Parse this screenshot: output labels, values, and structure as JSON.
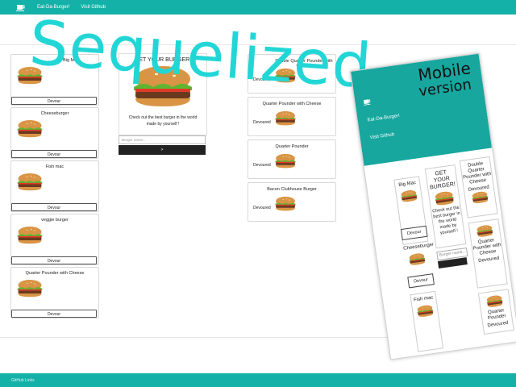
{
  "nav": {
    "brand": "Eat-Da-Burger!",
    "github": "Visit Github"
  },
  "watermark": "Sequelized",
  "left_cards": [
    {
      "name": "Big Mac",
      "button": "Devour"
    },
    {
      "name": "Cheeseburger",
      "button": "Devour"
    },
    {
      "name": "Fish mac",
      "button": "Devour"
    },
    {
      "name": "veggie burger",
      "button": "Devour"
    },
    {
      "name": "Quarter Pounder with Cheese",
      "button": "Devour"
    }
  ],
  "center": {
    "title": "GET YOUR BURGER!",
    "text_line1": "Check out the best burger in the world",
    "text_line2": "made by yourself !",
    "input_placeholder": "Burger name...",
    "submit": ">"
  },
  "right_cards": [
    {
      "name": "Double Quarter Pounder with Cheese",
      "status": "Devoured"
    },
    {
      "name": "Quarter Pounder with Cheese",
      "status": "Devoured"
    },
    {
      "name": "Quarter Pounder",
      "status": "Devoured"
    },
    {
      "name": "Bacon Clubhouse Burger",
      "status": "Devoured"
    }
  ],
  "footer": "GitHub Links",
  "mobile": {
    "tag_line1": "Mobile",
    "tag_line2": "version",
    "brand": "Eat-Da-Burger!",
    "github": "Visit Github",
    "left_cards": [
      {
        "name": "Big Mac",
        "button": "Devour"
      },
      {
        "name": "Cheeseburger",
        "button": "Devour"
      },
      {
        "name": "Fish mac",
        "button": ""
      }
    ],
    "center_title": "GET YOUR BURGER!",
    "center_text": "Check out the best burger in the world made by yourself !",
    "input_placeholder": "Burger name...",
    "right_cards": [
      {
        "name": "Double Quarter Pounder with Cheese",
        "status": "Devoured"
      },
      {
        "name": "Quarter Pounder with Cheese",
        "status": "Devoured"
      },
      {
        "name": "Quarter Pounder",
        "status": "Devoured"
      }
    ]
  },
  "colors": {
    "teal": "#14b1a8",
    "watermark": "#22d6d6",
    "dark": "#222222"
  },
  "icons": {
    "logo": "coffee-cup-icon",
    "burger": "burger-icon"
  }
}
